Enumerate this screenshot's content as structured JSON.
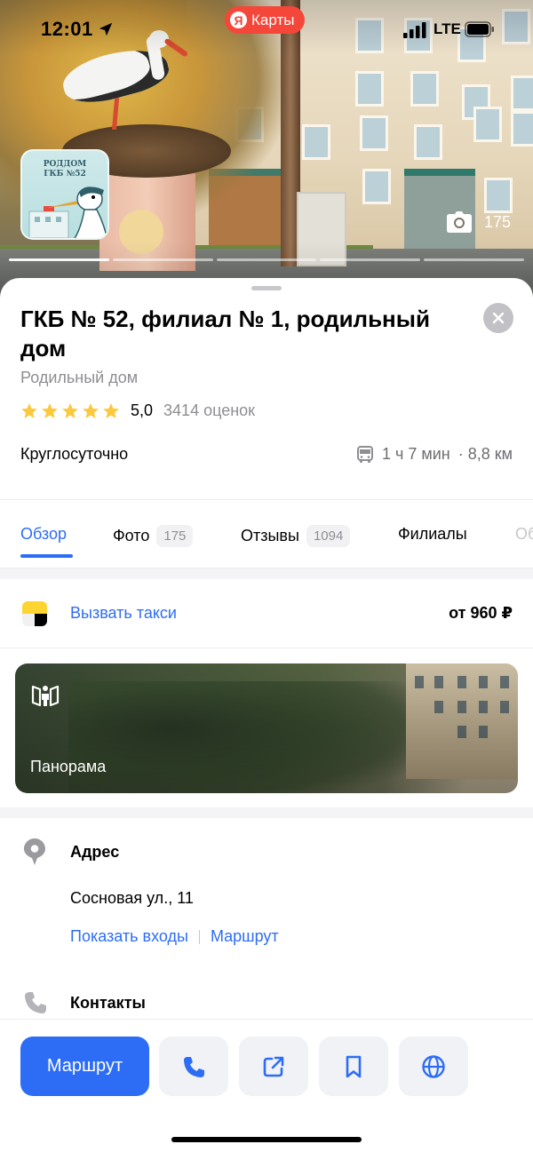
{
  "status_bar": {
    "time": "12:01",
    "network": "LTE"
  },
  "brand": {
    "logo_letter": "Я",
    "name": "Карты"
  },
  "hero": {
    "logo_text_line1": "РОДДОМ",
    "logo_text_line2": "ГКБ №52",
    "photo_count": "175"
  },
  "place": {
    "title": "ГКБ № 52, филиал № 1, родильный дом",
    "category": "Родильный дом",
    "rating": "5,0",
    "rating_count": "3414 оценок",
    "stars_filled": 5,
    "hours": "Круглосуточно",
    "travel_time": "1 ч 7 мин",
    "travel_distance": "· 8,8 км"
  },
  "tabs": [
    {
      "label": "Обзор",
      "badge": ""
    },
    {
      "label": "Фото",
      "badge": "175"
    },
    {
      "label": "Отзывы",
      "badge": "1094"
    },
    {
      "label": "Филиалы",
      "badge": ""
    },
    {
      "label": "Об",
      "badge": ""
    }
  ],
  "taxi": {
    "label": "Вызвать такси",
    "price": "от 960 ₽"
  },
  "panorama": {
    "label": "Панорама"
  },
  "address": {
    "title": "Адрес",
    "text": "Сосновая ул., 11",
    "link_entrances": "Показать входы",
    "link_route": "Маршрут"
  },
  "contacts": {
    "title": "Контакты"
  },
  "actions": {
    "route_label": "Маршрут",
    "icons": [
      "phone-icon",
      "share-icon",
      "bookmark-icon",
      "globe-icon"
    ]
  },
  "colors": {
    "accent": "#2d6df6",
    "brand_red": "#f4473a",
    "star": "#fbc93d",
    "taxi_yellow": "#fcd531"
  }
}
